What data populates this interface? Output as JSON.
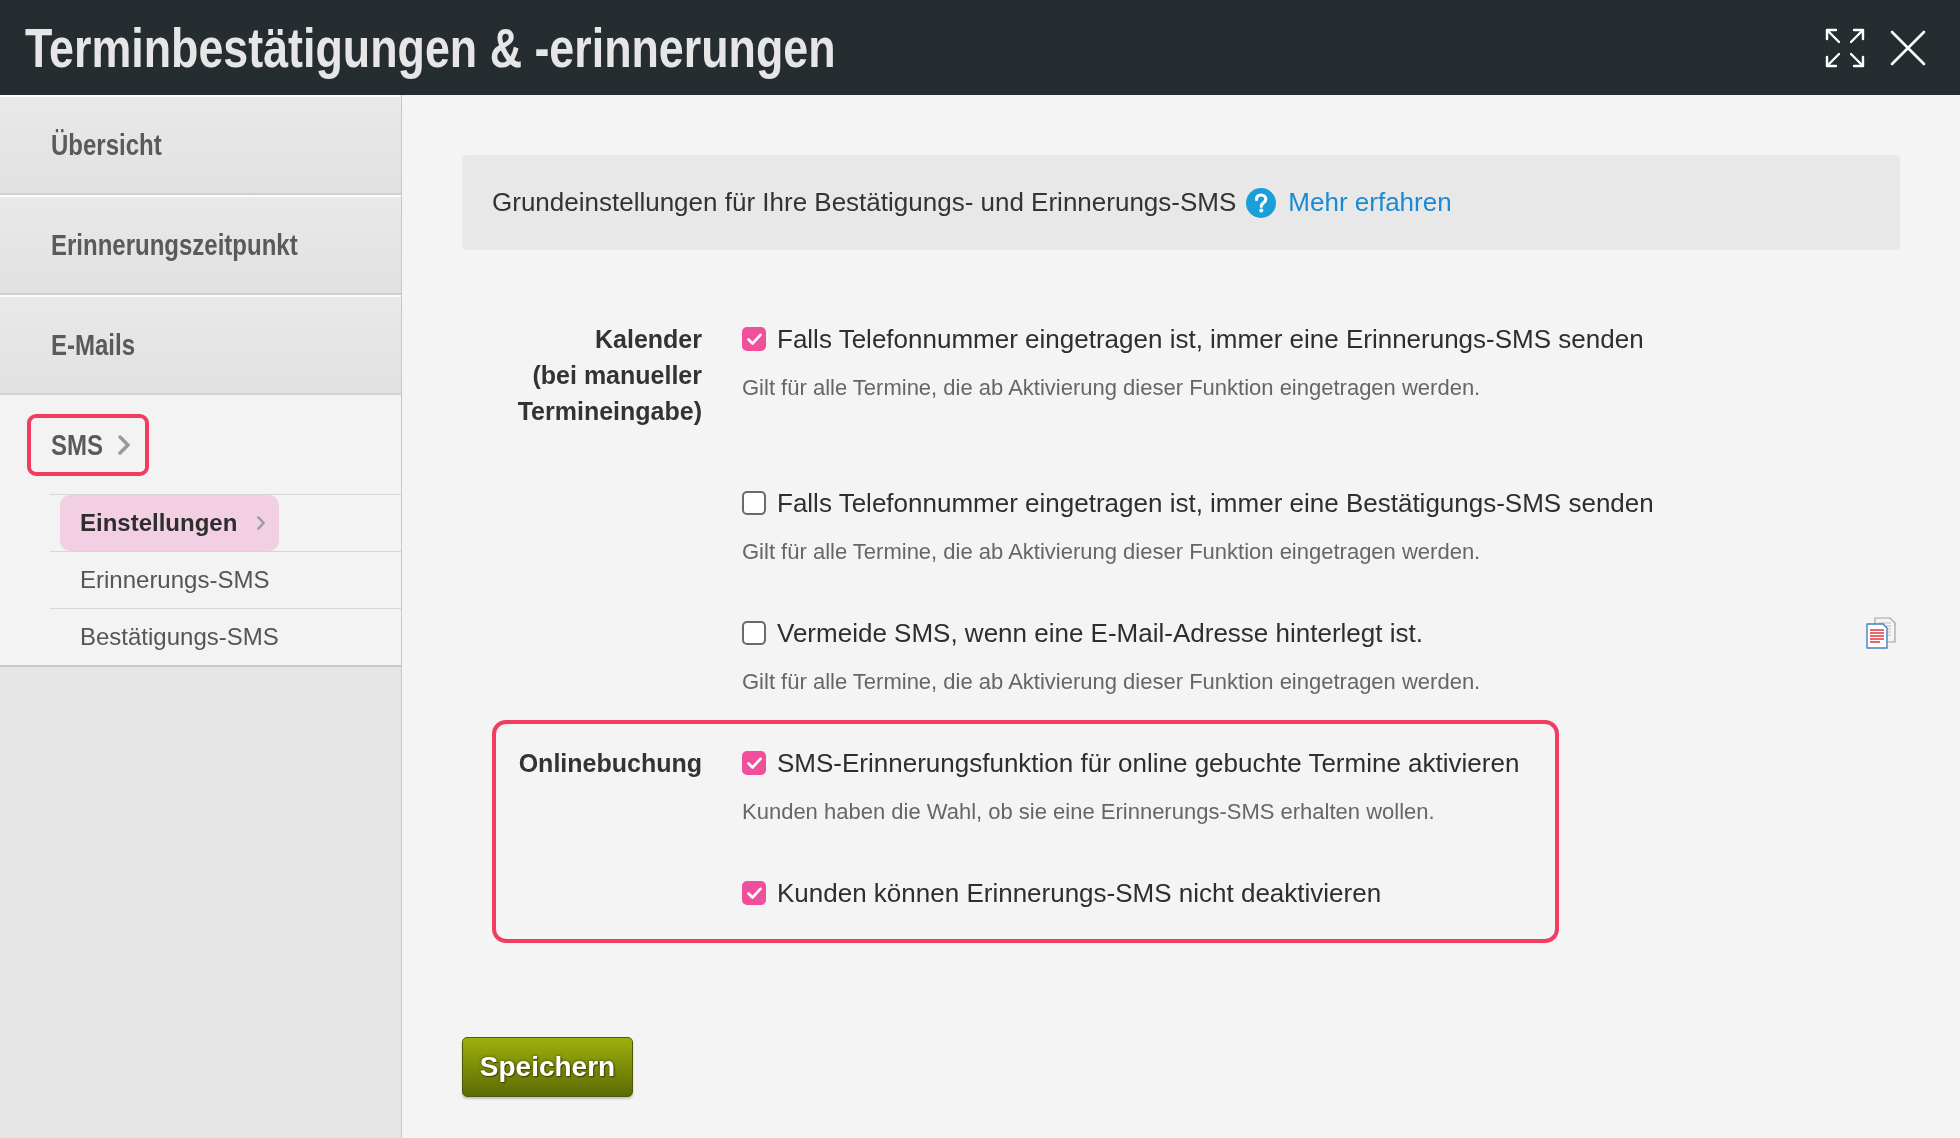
{
  "window": {
    "title": "Terminbestätigungen & -erinnerungen"
  },
  "sidebar": {
    "items": [
      {
        "label": "Übersicht",
        "selected": false,
        "highlighted": false
      },
      {
        "label": "Erinnerungszeitpunkt",
        "selected": false,
        "highlighted": false
      },
      {
        "label": "E-Mails",
        "selected": false,
        "highlighted": false
      },
      {
        "label": "SMS",
        "selected": true,
        "highlighted": true,
        "children": [
          {
            "label": "Einstellungen",
            "selected": true
          },
          {
            "label": "Erinnerungs-SMS",
            "selected": false
          },
          {
            "label": "Bestätigungs-SMS",
            "selected": false
          }
        ]
      }
    ]
  },
  "intro": {
    "text": "Grundeinstellungen für Ihre Bestätigungs- und Erinnerungs-SMS",
    "link": "Mehr erfahren"
  },
  "sections": [
    {
      "label": "Kalender\n(bei manueller\nTermineingabe)",
      "highlighted": false,
      "options": [
        {
          "label": "Falls Telefonnummer eingetragen ist, immer eine Erinnerungs-SMS senden",
          "checked": true,
          "hint": "Gilt für alle Termine, die ab Aktivierung dieser Funktion eingetragen werden.",
          "side_icon": false
        },
        {
          "label": "Falls Telefonnummer eingetragen ist, immer eine Bestätigungs-SMS senden",
          "checked": false,
          "hint": "Gilt für alle Termine, die ab Aktivierung dieser Funktion eingetragen werden.",
          "side_icon": false
        },
        {
          "label": "Vermeide SMS, wenn eine E-Mail-Adresse hinterlegt ist.",
          "checked": false,
          "hint": "Gilt für alle Termine, die ab Aktivierung dieser Funktion eingetragen werden.",
          "side_icon": true
        }
      ]
    },
    {
      "label": "Onlinebuchung",
      "highlighted": true,
      "options": [
        {
          "label": "SMS-Erinnerungsfunktion für online gebuchte Termine aktivieren",
          "checked": true,
          "hint": "Kunden haben die Wahl, ob sie eine Erinnerungs-SMS erhalten wollen.",
          "side_icon": false
        },
        {
          "label": "Kunden können Erinnerungs-SMS nicht deaktivieren",
          "checked": true,
          "side_icon": false
        }
      ]
    }
  ],
  "save_button": "Speichern"
}
